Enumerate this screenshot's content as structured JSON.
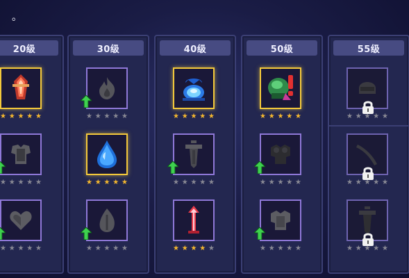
{
  "top_mark": "。",
  "columns": [
    {
      "label": "20级"
    },
    {
      "label": "30级"
    },
    {
      "label": "40级"
    },
    {
      "label": "50级"
    },
    {
      "label": "55级"
    }
  ],
  "slots": {
    "c0r0": {
      "icon": "red-sword-crystal-icon",
      "stars": 5,
      "locked": false,
      "upgrade": false
    },
    "c0r1": {
      "icon": "gray-armor-icon",
      "stars": 0,
      "locked": false,
      "upgrade": true
    },
    "c0r2": {
      "icon": "gray-heart-icon",
      "stars": 0,
      "locked": false,
      "upgrade": true
    },
    "c1r0": {
      "icon": "gray-flame-icon",
      "stars": 0,
      "locked": false,
      "upgrade": true
    },
    "c1r1": {
      "icon": "blue-water-drop-icon",
      "stars": 5,
      "locked": false,
      "upgrade": false
    },
    "c1r2": {
      "icon": "gray-leaf-flame-icon",
      "stars": 0,
      "locked": false,
      "upgrade": true
    },
    "c2r0": {
      "icon": "blue-shield-orb-icon",
      "stars": 5,
      "locked": false,
      "upgrade": false
    },
    "c2r1": {
      "icon": "gray-sword-icon",
      "stars": 0,
      "locked": false,
      "upgrade": true
    },
    "c2r2": {
      "icon": "red-arrow-sword-icon",
      "stars": 4,
      "locked": false,
      "upgrade": false
    },
    "c3r0": {
      "icon": "green-helmet-alert-icon",
      "stars": 5,
      "locked": false,
      "upgrade": false
    },
    "c3r1": {
      "icon": "dark-armor-icon",
      "stars": 0,
      "locked": false,
      "upgrade": true
    },
    "c3r2": {
      "icon": "gray-armor-icon",
      "stars": 0,
      "locked": false,
      "upgrade": true
    },
    "c4r0": {
      "icon": "gray-helmet-icon",
      "stars": 0,
      "locked": true,
      "upgrade": false
    },
    "c4r1": {
      "icon": "gray-blade-icon",
      "stars": 0,
      "locked": true,
      "upgrade": false
    },
    "c4r2": {
      "icon": "gray-sword-icon",
      "stars": 0,
      "locked": true,
      "upgrade": false
    }
  },
  "colors": {
    "star_on": "#f5b82e",
    "star_off": "#8a8a95",
    "frame_gold": "#f4c93b",
    "frame_purple": "#8f78d8",
    "upgrade_green": "#3fd14f"
  }
}
